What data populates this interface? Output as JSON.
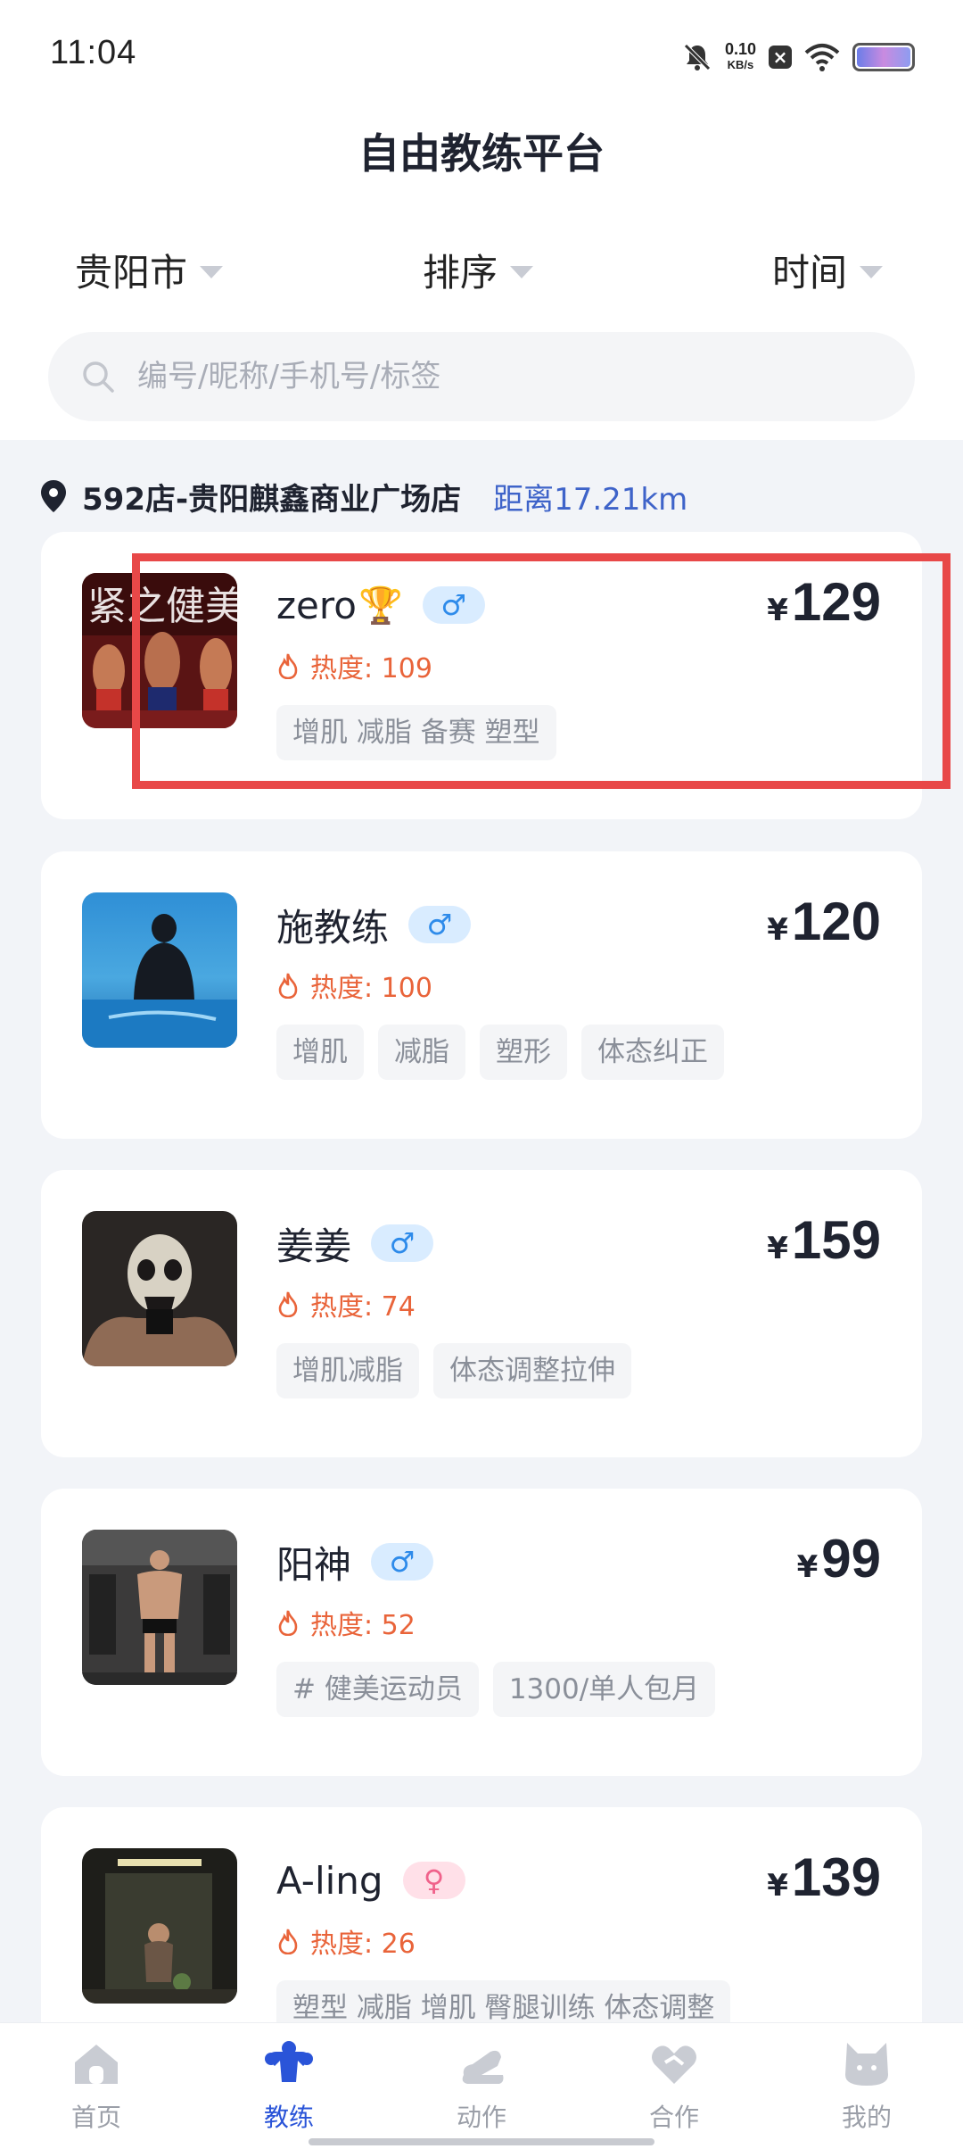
{
  "status_bar": {
    "time": "11:04",
    "net_speed_value": "0.10",
    "net_speed_unit": "KB/s"
  },
  "page": {
    "title": "自由教练平台"
  },
  "filters": {
    "city": "贵阳市",
    "sort": "排序",
    "time": "时间"
  },
  "search": {
    "placeholder": "编号/昵称/手机号/标签"
  },
  "store": {
    "name": "592店-贵阳麒鑫商业广场店",
    "distance": "距离17.21km"
  },
  "coaches": [
    {
      "name": "zero",
      "badge_icon": "trophy-icon",
      "gender": "♂",
      "heat": "热度: 109",
      "currency": "¥",
      "price": "129",
      "tags": [
        "增肌 减脂 备赛 塑型"
      ]
    },
    {
      "name": "施教练",
      "gender": "♂",
      "heat": "热度: 100",
      "currency": "¥",
      "price": "120",
      "tags": [
        "增肌",
        "减脂",
        "塑形",
        "体态纠正"
      ]
    },
    {
      "name": "姜姜",
      "gender": "♂",
      "heat": "热度: 74",
      "currency": "¥",
      "price": "159",
      "tags": [
        "增肌减脂",
        "体态调整拉伸"
      ]
    },
    {
      "name": "阳神",
      "gender": "♂",
      "heat": "热度: 52",
      "currency": "¥",
      "price": "99",
      "tags": [
        "# 健美运动员",
        "1300/单人包月"
      ]
    },
    {
      "name": "A-ling",
      "gender": "♀",
      "heat": "热度: 26",
      "currency": "¥",
      "price": "139",
      "tags": [
        "塑型 减脂 增肌 臀腿训练 体态调整"
      ]
    }
  ],
  "tabbar": {
    "items": [
      {
        "label": "首页",
        "icon": "home-icon"
      },
      {
        "label": "教练",
        "icon": "coach-icon",
        "active": true
      },
      {
        "label": "动作",
        "icon": "action-icon"
      },
      {
        "label": "合作",
        "icon": "handshake-icon"
      },
      {
        "label": "我的",
        "icon": "profile-icon"
      }
    ]
  },
  "colors": {
    "accent": "#2a54d8",
    "heat": "#e9643a",
    "distance": "#3e63c9",
    "highlight": "#e84848"
  }
}
